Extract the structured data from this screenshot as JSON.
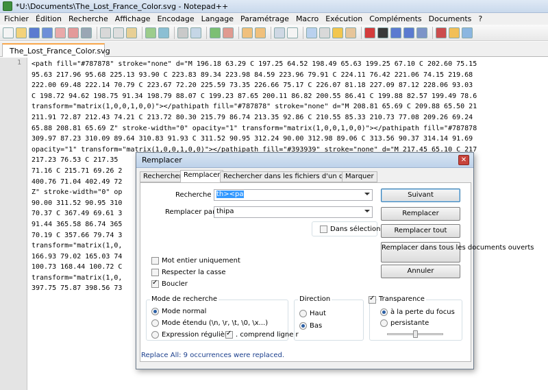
{
  "window": {
    "title": "*U:\\Documents\\The_Lost_France_Color.svg - Notepad++"
  },
  "menu": [
    "Fichier",
    "Édition",
    "Recherche",
    "Affichage",
    "Encodage",
    "Langage",
    "Paramétrage",
    "Macro",
    "Exécution",
    "Compléments",
    "Documents",
    "?"
  ],
  "file_tab": {
    "label": "The_Lost_France_Color.svg"
  },
  "editor": {
    "line_number": "1",
    "lines": [
      "<path fill=\"#787878\" stroke=\"none\" d=\"M 196.18 63.29 C 197.25 64.52 198.49 65.63 199.25 67.10 C 202.60 75.15",
      "95.63 217.96 95.68 225.13 93.90 C 223.83 89.34 223.98 84.59 223.96 79.91 C 224.11 76.42 221.06 74.15 219.68",
      "222.00 69.48 222.14 70.79 C 223.67 72.20 225.59 73.35 226.66 75.17 C 226.07 81.18 227.09 87.12 228.06 93.03",
      "C 198.72 94.62 198.75 91.34 198.79 88.07 C 199.23 87.65 200.11 86.82 200.55 86.41 C 199.88 82.57 199.49 78.6",
      "transform=\"matrix(1,0,0,1,0,0)\"></pathipath fill=\"#787878\" stroke=\"none\" d=\"M 208.81 65.69 C 209.88 65.50 21",
      "211.91 72.87 212.43 74.21 C 213.72 80.30 215.79 86.74 213.35 92.86 C 210.55 85.33 210.73 77.08 209.26 69.24",
      "65.88 208.81 65.69 Z\" stroke-width=\"0\" opacity=\"1\" transform=\"matrix(1,0,0,1,0,0)\"></pathipath fill=\"#787878",
      "309.97 87.23 310.09 89.64 310.83 91.93 C 311.52 90.95 312.24 90.00 312.98 89.06 C 313.56 90.37 314.14 91.69",
      "opacity=\"1\" transform=\"matrix(1,0,0,1,0,0)\"></pathipath fill=\"#393939\" stroke=\"none\" d=\"M 217.45 65.10 C 217",
      "217.23 76.53 C 217.35                                                               C 215.79 86.7",
      "71.16 C 215.71 69.26 2                                                              rix(1,0,0,1,0,",
      "400.76 71.04 402.49 72                                                              6 395.81 73.80",
      "Z\" stroke-width=\"0\" op                                                              troke=\"none\" d=",
      "90.00 311.52 90.95 310                                                              3 72.42 314.43",
      "70.37 C 367.49 69.61 3                                                              72 95.79 367.3",
      "91.44 365.58 86.74 365                                                              opacity=\"1\" tra",
      "70.19 C 357.66 79.74 3                                                              55.73 91.01 356",
      "transform=\"matrix(1,0,                                                              161.14 72.77 16",
      "166.93 79.02 165.03 74                                                              168.52 98.28",
      "100.73 168.44 100.72 C                                                              165.72 101.54",
      "transform=\"matrix(1,0,                                                              397.89 72.96 40",
      "397.75 75.87 398.56 73                                                              y=\"1\" transform"
    ]
  },
  "dialog": {
    "title": "Remplacer",
    "close_icon_glyph": "✕",
    "tabs": [
      "Rechercher",
      "Remplacer",
      "Rechercher dans les fichiers d'un dossier",
      "Marquer"
    ],
    "search_label": "Recherche :",
    "search_value": "th><pa",
    "replace_label": "Remplacer par :",
    "replace_value": "thipa",
    "in_selection_label": "Dans sélection",
    "in_selection_checked": false,
    "buttons": {
      "next": "Suivant",
      "replace": "Remplacer",
      "replace_all": "Remplacer tout",
      "replace_all_open_docs": "Remplacer dans tous les documents ouverts",
      "cancel": "Annuler"
    },
    "options": [
      {
        "label": "Mot entier uniquement",
        "checked": false
      },
      {
        "label": "Respecter la casse",
        "checked": false
      },
      {
        "label": "Boucler",
        "checked": true
      }
    ],
    "search_mode": {
      "title": "Mode de recherche",
      "normal": "Mode normal",
      "extended": "Mode étendu (\\n, \\r, \\t, \\0, \\x...)",
      "regex": "Expression régulière",
      "dot_newline": ". comprend ligne r",
      "selected": "normal"
    },
    "direction": {
      "title": "Direction",
      "up": "Haut",
      "down": "Bas",
      "selected": "down"
    },
    "transparency": {
      "title": "Transparence",
      "enabled": true,
      "on_focus_lost": "à la perte du focus",
      "persistent": "persistante",
      "selected": "on_focus_lost"
    },
    "status": "Replace All: 9 occurrences were replaced."
  }
}
